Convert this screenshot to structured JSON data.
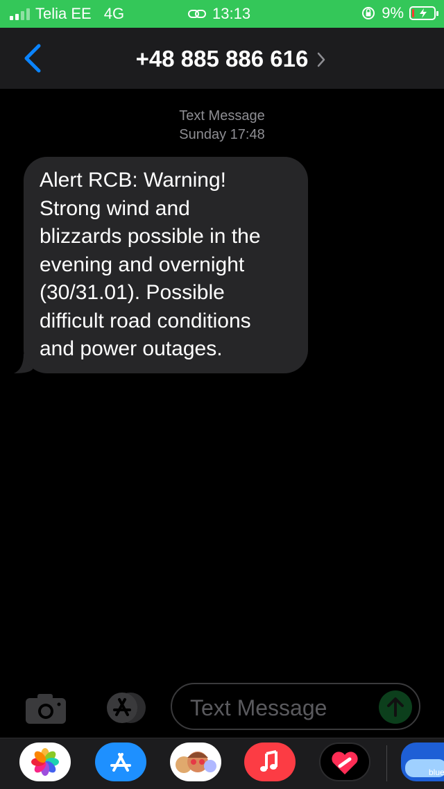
{
  "status_bar": {
    "carrier": "Telia EE",
    "network": "4G",
    "time": "13:13",
    "battery": "9%",
    "battery_fraction": 0.09,
    "background_color": "#34c759"
  },
  "nav": {
    "title": "+48 885 886 616",
    "back_icon": "chevron-left-icon",
    "detail_icon": "chevron-right-icon",
    "accent_color": "#0a84ff"
  },
  "conversation": {
    "service": "Text Message",
    "timestamp": "Sunday 17:48",
    "messages": [
      {
        "direction": "incoming",
        "lines": [
          "Alert RCB: Warning!",
          "Strong wind and",
          "blizzards possible in the",
          "evening and overnight",
          "(30/31.01). Possible",
          "difficult road conditions",
          "and power outages."
        ]
      }
    ]
  },
  "composer": {
    "placeholder": "Text Message",
    "camera_icon": "camera-icon",
    "apps_icon": "app-store-icon",
    "send_icon": "send-arrow-icon"
  },
  "app_drawer": {
    "apps": [
      {
        "name": "photos-icon"
      },
      {
        "name": "app-store-icon"
      },
      {
        "name": "memoji-icon"
      },
      {
        "name": "music-icon"
      },
      {
        "name": "heart-sticker-icon"
      },
      {
        "name": "blue-app-icon",
        "label": "blue"
      }
    ]
  }
}
